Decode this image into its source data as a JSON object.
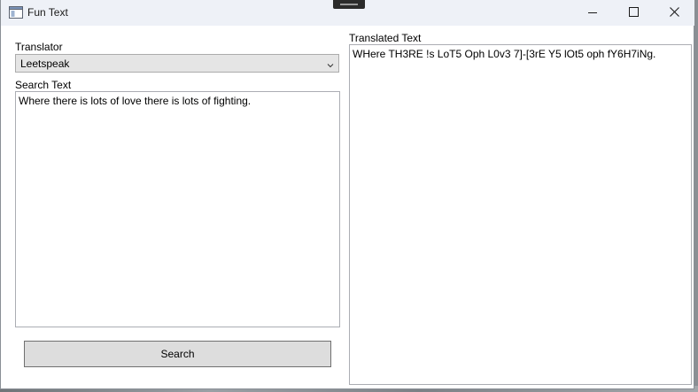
{
  "window": {
    "title": "Fun Text",
    "icon": "app-window-icon",
    "controls": {
      "minimize_icon": "minimize-icon",
      "maximize_icon": "maximize-icon",
      "close_icon": "close-icon"
    }
  },
  "translator": {
    "label": "Translator",
    "selected": "Leetspeak"
  },
  "search": {
    "label": "Search Text",
    "value": "Where there is lots of love there is lots of fighting.",
    "button_label": "Search"
  },
  "output": {
    "label": "Translated Text",
    "value": "WHere TH3RE !s LoT5 Oph L0v3 7]-[3rE Y5 lOt5 oph fY6H7iNg."
  },
  "colors": {
    "titlebar": "#eef1f7",
    "button_face": "#dddddd",
    "combo_face": "#e5e5e5"
  }
}
